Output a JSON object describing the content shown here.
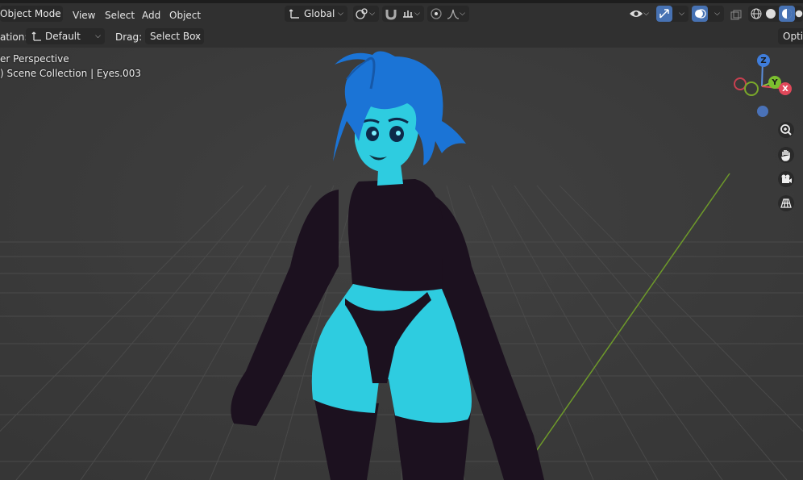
{
  "header": {
    "mode": "Object Mode",
    "menus": [
      "View",
      "Select",
      "Add",
      "Object"
    ],
    "transform_orientation": "Global",
    "options_label": "Optic"
  },
  "toolbar": {
    "orientation_label": "ation:",
    "orientation_value": "Default",
    "drag_label": "Drag:",
    "drag_value": "Select Box"
  },
  "viewport": {
    "view_name": "er Perspective",
    "collection_path": ") Scene Collection | Eyes.003"
  },
  "gizmo": {
    "axes": {
      "z": "Z",
      "y": "Y",
      "x": "X"
    }
  },
  "icons": {
    "header": [
      "orientation-icon",
      "snap-icon",
      "magnet-icon",
      "increment-icon",
      "proportional-icon",
      "falloff-icon",
      "visibility-icon",
      "gizmo-icon",
      "overlay-icon",
      "xray-icon",
      "wireframe-icon",
      "solid-icon",
      "material-icon",
      "rendered-icon"
    ],
    "nav": [
      "zoom-icon",
      "hand-icon",
      "camera-icon",
      "grid-icon"
    ]
  },
  "colors": {
    "viewport_bg": "#3b3b3b",
    "skin": "#2ecce0",
    "hair": "#1b74d6",
    "clothing": "#1c111f",
    "accent": "#4772b3",
    "y_axis_line": "#6e9a2a"
  }
}
